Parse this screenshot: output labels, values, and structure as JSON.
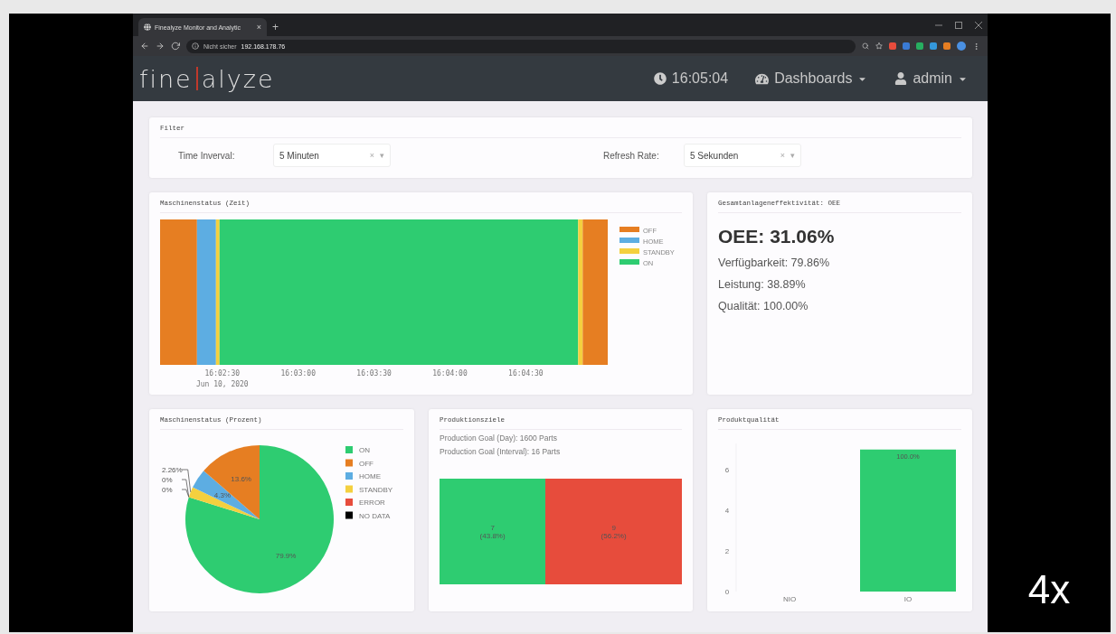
{
  "browser": {
    "tab_title": "Finealyze Monitor and Analytic",
    "tab_close": "×",
    "new_tab": "+",
    "security": "Nicht sicher",
    "address": "192.168.178.76"
  },
  "navbar": {
    "logo_left": "fine",
    "logo_right": "alyze",
    "time": "16:05:04",
    "dashboards": "Dashboards",
    "user": "admin"
  },
  "filter": {
    "title": "Filter",
    "fields": [
      {
        "label": "Time Inverval:",
        "value": "5 Minuten",
        "clear": "×",
        "caret": "▾"
      },
      {
        "label": "Refresh Rate:",
        "value": "5 Sekunden",
        "clear": "×",
        "caret": "▾"
      }
    ]
  },
  "status_time": {
    "title": "Maschinenstatus (Zeit)",
    "date_label": "Jun 10, 2020",
    "tick_labels": [
      "16:02:30",
      "16:03:00",
      "16:03:30",
      "16:04:00",
      "16:04:30"
    ],
    "legend": [
      {
        "label": "OFF",
        "color": "#e67e22"
      },
      {
        "label": "HOME",
        "color": "#5dade2"
      },
      {
        "label": "STANDBY",
        "color": "#f4d03f"
      },
      {
        "label": "ON",
        "color": "#2ecc71"
      }
    ]
  },
  "oee": {
    "title": "Gesamtanlageneffektivität: OEE",
    "headline": "OEE: 31.06%",
    "lines": [
      "Verfügbarkeit: 79.86%",
      "Leistung: 38.89%",
      "Qualität: 100.00%"
    ]
  },
  "status_percent": {
    "title": "Maschinenstatus (Prozent)",
    "chart_data": {
      "type": "pie",
      "categories": [
        "ON",
        "OFF",
        "HOME",
        "STANDBY",
        "ERROR",
        "NO DATA"
      ],
      "values": [
        79.9,
        13.6,
        4.3,
        2.26,
        0,
        0
      ],
      "colors": [
        "#2ecc71",
        "#e67e22",
        "#5dade2",
        "#f4d03f",
        "#e74c3c",
        "#000000"
      ],
      "value_labels": [
        "79.9%",
        "13.6%",
        "4.3%",
        "2.26%",
        "0%",
        "0%"
      ],
      "legend": "right"
    }
  },
  "production": {
    "title": "Produktionsziele",
    "lines": [
      "Production Goal (Day): 1600 Parts",
      "Production Goal (Interval): 16 Parts"
    ],
    "segments": [
      {
        "value": "7",
        "share": "(43.8%)",
        "color": "#2ecc71"
      },
      {
        "value": "9",
        "share": "(56.2%)",
        "color": "#e74c3c"
      }
    ]
  },
  "quality": {
    "title": "Produktqualität",
    "chart_data": {
      "type": "bar",
      "orientation": "vertical",
      "categories": [
        "NIO",
        "IO"
      ],
      "ylim": [
        0,
        7.3
      ],
      "yticks": [
        0,
        2,
        4,
        6
      ],
      "series": [
        {
          "color": "#2ecc71",
          "values": [
            0,
            7
          ]
        }
      ],
      "value_labels": [
        null,
        "100.0%"
      ]
    }
  },
  "speed_badge": "4x"
}
